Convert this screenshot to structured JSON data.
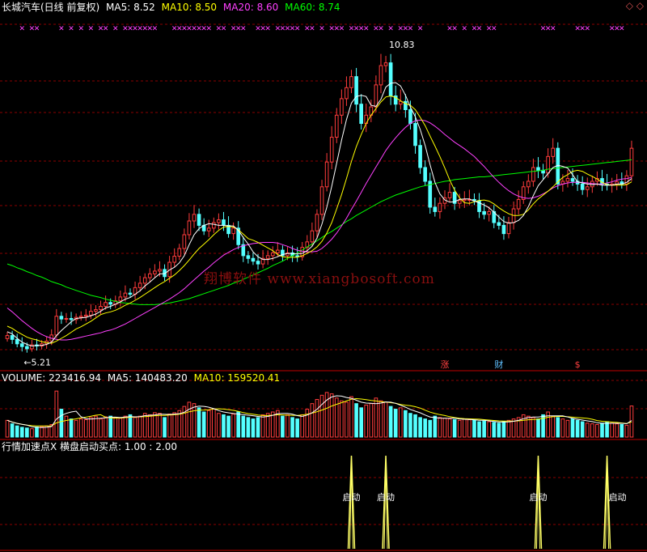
{
  "price_panel": {
    "title": "长城汽车(日线 前复权)",
    "ma5_label": "MA5: 8.52",
    "ma10_label": "MA10: 8.50",
    "ma20_label": "MA20: 8.60",
    "ma60_label": "MA60: 8.74",
    "corner_symbols": "◇ ◇",
    "high_label": "10.83",
    "low_label": "5.21",
    "event_labels": [
      "涨",
      "财",
      "$"
    ],
    "watermark": "翔博软件 www.xiangbosoft.com"
  },
  "volume_panel": {
    "volume_label": "VOLUME: 223416.94",
    "ma5_label": "MA5: 140483.20",
    "ma10_label": "MA10: 159520.41"
  },
  "indicator_panel": {
    "title": "行情加速点X 横盘启动买点: 1.00 : 2.00",
    "signal_label": "启动"
  },
  "colors": {
    "background": "#000000",
    "up_candle": "#ff3c3c",
    "down_candle": "#54ffff",
    "ma5": "#ffffff",
    "ma10": "#ffff00",
    "ma20": "#ff40ff",
    "ma60": "#00ff00",
    "grid": "#8b0000",
    "marker": "#ff40ff",
    "signal": "#ffff66"
  },
  "chart_data": {
    "type": "candlestick",
    "ylim": [
      5.0,
      11.2
    ],
    "closes": [
      5.55,
      5.48,
      5.4,
      5.35,
      5.31,
      5.38,
      5.36,
      5.4,
      5.45,
      5.56,
      5.9,
      5.85,
      5.86,
      5.84,
      5.88,
      5.9,
      5.92,
      5.99,
      6.02,
      6.08,
      6.15,
      6.12,
      6.18,
      6.25,
      6.32,
      6.3,
      6.42,
      6.5,
      6.6,
      6.67,
      6.72,
      6.75,
      6.62,
      6.88,
      6.99,
      7.13,
      7.38,
      7.63,
      7.75,
      7.55,
      7.45,
      7.5,
      7.6,
      7.65,
      7.55,
      7.4,
      7.5,
      7.2,
      7.0,
      6.95,
      6.9,
      6.85,
      6.95,
      7.0,
      7.05,
      7.1,
      7.0,
      7.05,
      7.0,
      6.98,
      7.15,
      7.25,
      7.45,
      7.75,
      8.25,
      8.7,
      9.15,
      9.55,
      9.85,
      10.05,
      10.25,
      9.75,
      9.4,
      9.55,
      9.7,
      10.1,
      10.45,
      10.5,
      9.9,
      9.75,
      9.8,
      9.65,
      9.4,
      9.0,
      8.6,
      8.35,
      7.88,
      7.8,
      7.95,
      8.05,
      8.15,
      7.95,
      8.0,
      8.02,
      8.02,
      8.0,
      7.8,
      7.75,
      7.8,
      7.6,
      7.55,
      7.4,
      7.6,
      7.85,
      8.02,
      8.25,
      8.35,
      8.6,
      8.55,
      8.5,
      8.8,
      8.95,
      8.3,
      8.35,
      8.4,
      8.35,
      8.3,
      8.2,
      8.25,
      8.35,
      8.4,
      8.3,
      8.28,
      8.3,
      8.34,
      8.3,
      8.45,
      8.95
    ],
    "volume_max": 360000,
    "volumes": [
      120,
      95,
      80,
      70,
      65,
      60,
      72,
      75,
      80,
      90,
      330,
      200,
      150,
      130,
      120,
      130,
      125,
      140,
      150,
      130,
      145,
      150,
      140,
      135,
      150,
      160,
      140,
      150,
      170,
      160,
      175,
      170,
      140,
      165,
      175,
      190,
      220,
      250,
      240,
      210,
      180,
      190,
      200,
      170,
      160,
      150,
      165,
      180,
      150,
      140,
      130,
      140,
      160,
      170,
      180,
      190,
      150,
      160,
      140,
      130,
      160,
      200,
      240,
      270,
      300,
      320,
      310,
      280,
      260,
      250,
      290,
      240,
      210,
      230,
      240,
      280,
      260,
      250,
      220,
      200,
      210,
      190,
      170,
      160,
      140,
      130,
      120,
      150,
      140,
      135,
      130,
      125,
      120,
      130,
      125,
      120,
      110,
      115,
      110,
      105,
      100,
      110,
      120,
      130,
      140,
      160,
      150,
      140,
      130,
      160,
      180,
      150,
      140,
      130,
      120,
      130,
      120,
      110,
      100,
      95,
      90,
      100,
      110,
      100,
      95,
      90,
      85,
      223
    ],
    "ma5": [
      5.62,
      5.58,
      5.5,
      5.43,
      5.39,
      5.36,
      5.37,
      5.37,
      5.39,
      5.43,
      5.55,
      5.64,
      5.72,
      5.8,
      5.86,
      5.87,
      5.88,
      5.91,
      5.94,
      5.99,
      6.05,
      6.08,
      6.12,
      6.16,
      6.21,
      6.24,
      6.3,
      6.36,
      6.45,
      6.52,
      6.6,
      6.67,
      6.67,
      6.74,
      6.79,
      6.87,
      7.0,
      7.2,
      7.38,
      7.49,
      7.55,
      7.58,
      7.57,
      7.55,
      7.55,
      7.54,
      7.54,
      7.46,
      7.33,
      7.21,
      7.07,
      6.98,
      6.93,
      6.93,
      6.95,
      6.98,
      7.02,
      7.04,
      7.04,
      7.03,
      7.04,
      7.09,
      7.17,
      7.32,
      7.57,
      7.88,
      8.26,
      8.68,
      9.1,
      9.47,
      9.77,
      9.89,
      9.91,
      9.89,
      9.73,
      9.71,
      9.84,
      10.06,
      10.13,
      10.14,
      10.08,
      9.91,
      9.7,
      9.52,
      9.29,
      9.0,
      8.65,
      8.33,
      8.12,
      8.01,
      7.97,
      7.98,
      8.02,
      8.03,
      8.03,
      7.99,
      7.96,
      7.92,
      7.87,
      7.79,
      7.7,
      7.62,
      7.59,
      7.6,
      7.64,
      7.73,
      7.89,
      8.09,
      8.27,
      8.38,
      8.49,
      8.6,
      8.64,
      8.62,
      8.59,
      8.47,
      8.34,
      8.32,
      8.3,
      8.29,
      8.3,
      8.28,
      8.28,
      8.28,
      8.3,
      8.3,
      8.33,
      8.4
    ],
    "ma10": [
      5.72,
      5.68,
      5.62,
      5.57,
      5.52,
      5.49,
      5.47,
      5.44,
      5.42,
      5.41,
      5.45,
      5.5,
      5.55,
      5.61,
      5.67,
      5.71,
      5.76,
      5.81,
      5.87,
      5.93,
      5.96,
      5.98,
      6.01,
      6.05,
      6.1,
      6.14,
      6.19,
      6.24,
      6.3,
      6.36,
      6.42,
      6.48,
      6.53,
      6.59,
      6.65,
      6.73,
      6.82,
      6.92,
      7.03,
      7.13,
      7.21,
      7.29,
      7.38,
      7.46,
      7.52,
      7.53,
      7.52,
      7.47,
      7.39,
      7.31,
      7.28,
      7.24,
      7.19,
      7.14,
      7.09,
      7.02,
      6.98,
      6.97,
      6.97,
      6.97,
      7.0,
      7.04,
      7.09,
      7.16,
      7.26,
      7.41,
      7.6,
      7.85,
      8.11,
      8.4,
      8.71,
      8.98,
      9.2,
      9.4,
      9.55,
      9.67,
      9.79,
      9.88,
      9.9,
      9.87,
      9.81,
      9.76,
      9.73,
      9.65,
      9.51,
      9.36,
      9.17,
      8.99,
      8.8,
      8.59,
      8.37,
      8.19,
      8.05,
      7.96,
      7.95,
      7.98,
      8.0,
      8.01,
      7.99,
      7.94,
      7.87,
      7.81,
      7.76,
      7.73,
      7.73,
      7.75,
      7.83,
      7.94,
      8.03,
      8.1,
      8.17,
      8.25,
      8.34,
      8.42,
      8.47,
      8.53,
      8.55,
      8.53,
      8.48,
      8.44,
      8.39,
      8.33,
      8.29,
      8.28,
      8.28,
      8.28,
      8.29,
      8.34
    ],
    "ma20": [
      6.05,
      5.98,
      5.9,
      5.82,
      5.75,
      5.68,
      5.62,
      5.57,
      5.53,
      5.5,
      5.48,
      5.47,
      5.47,
      5.48,
      5.5,
      5.52,
      5.54,
      5.56,
      5.58,
      5.6,
      5.63,
      5.65,
      5.68,
      5.72,
      5.76,
      5.81,
      5.86,
      5.91,
      5.96,
      6.01,
      6.06,
      6.11,
      6.16,
      6.21,
      6.27,
      6.33,
      6.4,
      6.48,
      6.56,
      6.64,
      6.72,
      6.79,
      6.87,
      6.94,
      7.01,
      7.06,
      7.11,
      7.15,
      7.18,
      7.2,
      7.22,
      7.23,
      7.24,
      7.24,
      7.24,
      7.23,
      7.2,
      7.17,
      7.13,
      7.1,
      7.08,
      7.07,
      7.07,
      7.08,
      7.13,
      7.21,
      7.3,
      7.41,
      7.54,
      7.68,
      7.84,
      7.99,
      8.15,
      8.31,
      8.46,
      8.61,
      8.76,
      8.91,
      9.03,
      9.14,
      9.24,
      9.33,
      9.4,
      9.45,
      9.46,
      9.45,
      9.41,
      9.35,
      9.28,
      9.2,
      9.13,
      9.06,
      9.0,
      8.94,
      8.87,
      8.8,
      8.71,
      8.62,
      8.52,
      8.42,
      8.33,
      8.25,
      8.18,
      8.12,
      8.08,
      8.05,
      8.04,
      8.05,
      8.08,
      8.12,
      8.17,
      8.23,
      8.27,
      8.3,
      8.32,
      8.33,
      8.33,
      8.33,
      8.32,
      8.31,
      8.3,
      8.3,
      8.32,
      8.34,
      8.37,
      8.39,
      8.4,
      8.42
    ],
    "ma60": [
      6.85,
      6.82,
      6.78,
      6.75,
      6.71,
      6.68,
      6.64,
      6.61,
      6.57,
      6.53,
      6.5,
      6.47,
      6.43,
      6.4,
      6.37,
      6.34,
      6.31,
      6.28,
      6.26,
      6.24,
      6.21,
      6.19,
      6.17,
      6.15,
      6.14,
      6.13,
      6.12,
      6.11,
      6.11,
      6.11,
      6.11,
      6.12,
      6.13,
      6.14,
      6.16,
      6.18,
      6.2,
      6.22,
      6.25,
      6.28,
      6.31,
      6.34,
      6.37,
      6.4,
      6.43,
      6.46,
      6.5,
      6.53,
      6.57,
      6.61,
      6.65,
      6.69,
      6.73,
      6.77,
      6.82,
      6.86,
      6.9,
      6.95,
      7.0,
      7.05,
      7.1,
      7.16,
      7.21,
      7.27,
      7.33,
      7.39,
      7.44,
      7.5,
      7.56,
      7.62,
      7.67,
      7.73,
      7.78,
      7.83,
      7.88,
      7.93,
      7.98,
      8.02,
      8.06,
      8.1,
      8.13,
      8.16,
      8.19,
      8.22,
      8.25,
      8.27,
      8.29,
      8.31,
      8.33,
      8.35,
      8.36,
      8.38,
      8.39,
      8.4,
      8.41,
      8.42,
      8.43,
      8.43,
      8.44,
      8.45,
      8.46,
      8.47,
      8.48,
      8.49,
      8.5,
      8.51,
      8.52,
      8.53,
      8.54,
      8.55,
      8.57,
      8.58,
      8.59,
      8.6,
      8.61,
      8.62,
      8.63,
      8.64,
      8.65,
      8.66,
      8.67,
      8.68,
      8.69,
      8.7,
      8.71,
      8.72,
      8.73,
      8.74
    ],
    "signal_indices": [
      70,
      77,
      108,
      122
    ],
    "marker_indices": [
      3,
      5,
      6,
      11,
      13,
      15,
      17,
      19,
      20,
      22,
      24,
      25,
      26,
      27,
      28,
      29,
      30,
      34,
      35,
      36,
      37,
      38,
      39,
      40,
      41,
      43,
      44,
      46,
      47,
      48,
      51,
      52,
      53,
      55,
      56,
      57,
      58,
      59,
      61,
      62,
      64,
      66,
      67,
      68,
      70,
      71,
      72,
      73,
      75,
      76,
      78,
      80,
      81,
      82,
      84,
      90,
      91,
      93,
      95,
      96,
      98,
      99,
      109,
      110,
      111,
      116,
      117,
      118,
      123,
      124,
      125
    ],
    "event_indices": [
      89,
      100,
      116
    ]
  }
}
